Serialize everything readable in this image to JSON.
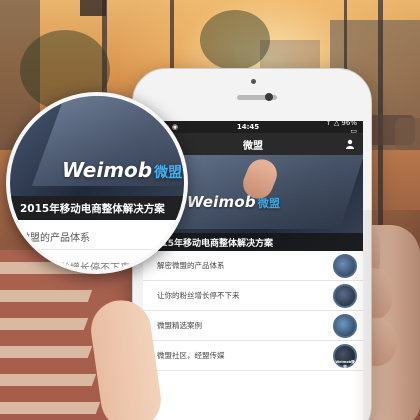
{
  "phone": {
    "status": {
      "signal": "••••• ◉",
      "time": "14:45",
      "battery": "↑ △ 96% ▭"
    },
    "nav": {
      "back": "‹",
      "title": "微盟"
    },
    "banner": {
      "brand_latin": "Weimob",
      "brand_cn": "微盟",
      "caption": "2015年移动电商整体解决方案"
    },
    "list": [
      {
        "label": "解密微盟的产品体系",
        "thumb_tag": ""
      },
      {
        "label": "让你的粉丝增长停不下来",
        "thumb_tag": ""
      },
      {
        "label": "微盟精选案例",
        "thumb_tag": ""
      },
      {
        "label": "微盟社区，经盟传媒",
        "thumb_tag": "Weimob微盟"
      }
    ]
  },
  "magnifier": {
    "brand_latin": "Weimob",
    "brand_cn": "微盟",
    "caption": "2015年移动电商整体解决方案",
    "rows": [
      "微盟的产品体系",
      "得你的粉丝增长停不下来"
    ]
  },
  "icons": {
    "user": "user-icon",
    "back": "chevron-left-icon"
  }
}
